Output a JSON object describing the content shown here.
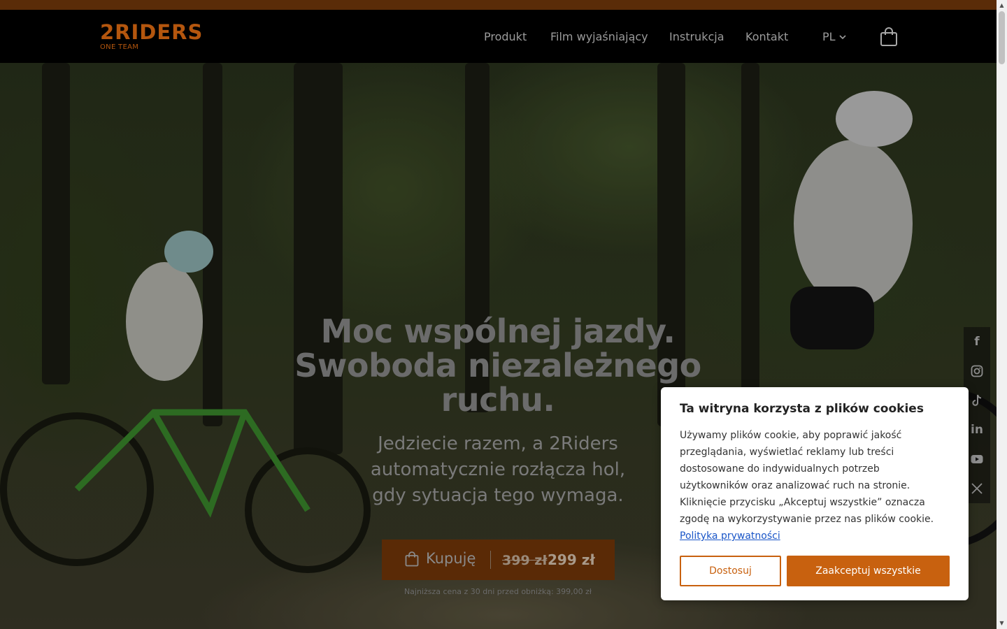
{
  "brand": {
    "name": "2RIDERS",
    "tagline": "ONE TEAM",
    "accent": "#c8610f"
  },
  "nav": {
    "items": [
      "Produkt",
      "Film wyjaśniający",
      "Instrukcja",
      "Kontakt"
    ],
    "language": "PL"
  },
  "header": {
    "cart_icon": "shopping-bag-icon"
  },
  "hero": {
    "title_lines": [
      "Moc wspólnej jazdy.",
      "Swoboda niezależnego",
      "ruchu."
    ],
    "subtitle_lines": [
      "Jedziecie razem, a 2Riders",
      "automatycznie rozłącza hol,",
      "gdy sytuacja tego wymaga."
    ],
    "buy_button": {
      "label": "Kupuję",
      "old_price": "399 zł",
      "new_price": "299 zł"
    },
    "lowest_price_note": "Najniższa cena z 30 dni przed obniżką: 399,00 zł"
  },
  "social": [
    "facebook-icon",
    "instagram-icon",
    "tiktok-icon",
    "linkedin-icon",
    "youtube-icon",
    "x-icon"
  ],
  "cookie": {
    "title": "Ta witryna korzysta z plików cookies",
    "body": "Używamy plików cookie, aby poprawić jakość przeglądania, wyświetlać reklamy lub treści dostosowane do indywidualnych potrzeb użytkowników oraz analizować ruch na stronie. Kliknięcie przycisku „Akceptuj wszystkie” oznacza zgodę na wykorzystywanie przez nas plików cookie.",
    "link_text": "Polityka prywatności",
    "customize_label": "Dostosuj",
    "accept_label": "Zaakceptuj wszystkie"
  }
}
